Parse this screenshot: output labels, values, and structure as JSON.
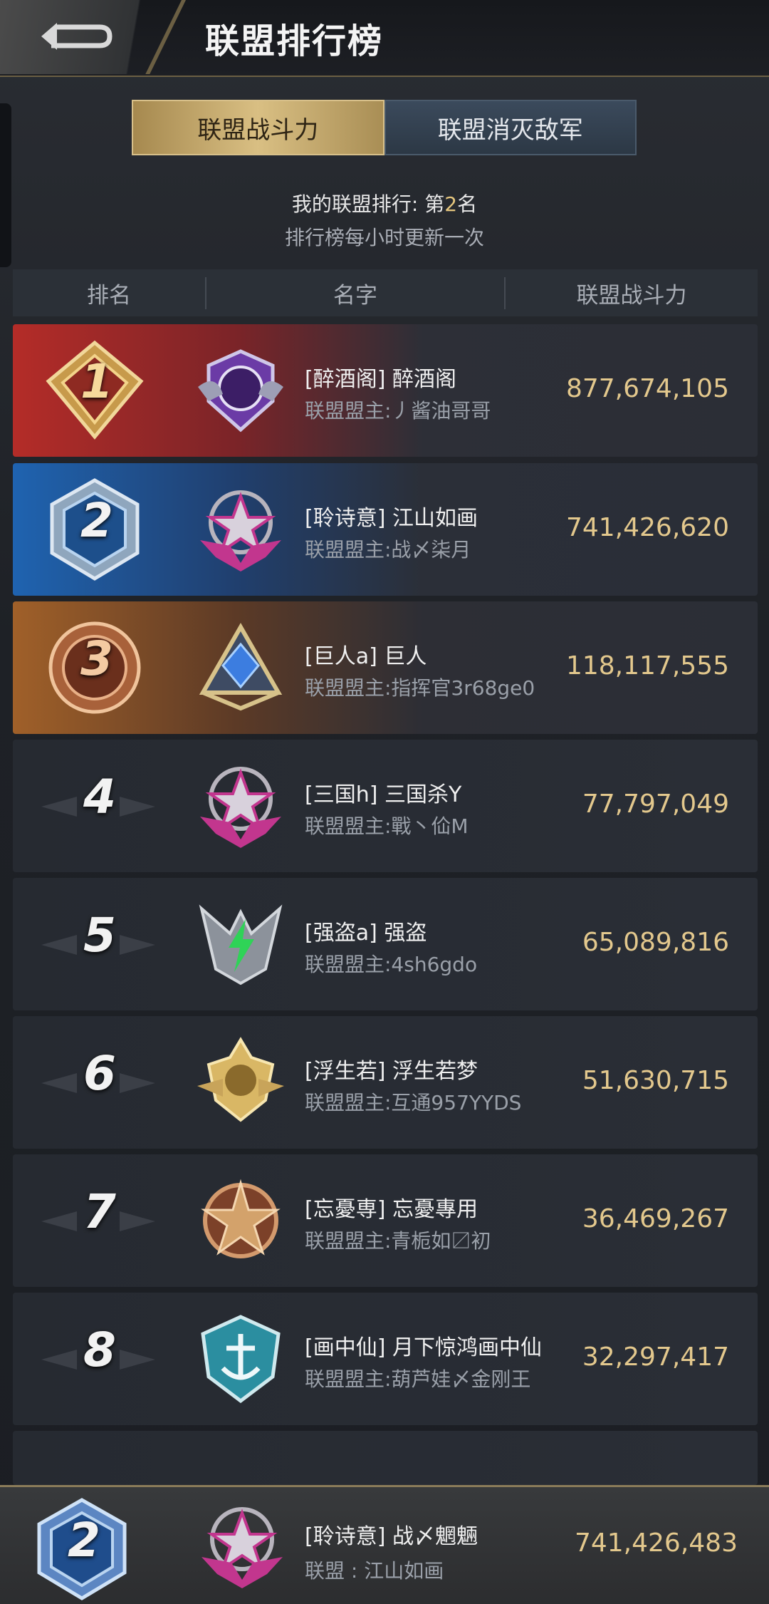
{
  "header": {
    "title": "联盟排行榜"
  },
  "tabs": [
    {
      "label": "联盟战斗力",
      "active": true
    },
    {
      "label": "联盟消灭敌军",
      "active": false
    }
  ],
  "my_rank": {
    "prefix": "我的联盟排行: 第",
    "rank": "2",
    "suffix": "名"
  },
  "update_note": "排行榜每小时更新一次",
  "columns": {
    "rank": "排名",
    "name": "名字",
    "power": "联盟战斗力"
  },
  "rows": [
    {
      "rank": "1",
      "name": "[醉酒阁] 醉酒阁",
      "leader": "联盟盟主:丿酱油哥哥",
      "power": "877,674,105",
      "emblem": "purple-tiger-emblem-icon"
    },
    {
      "rank": "2",
      "name": "[聆诗意] 江山如画",
      "leader": "联盟盟主:战〆柒月",
      "power": "741,426,620",
      "emblem": "pink-star-emblem-icon"
    },
    {
      "rank": "3",
      "name": "[巨人a] 巨人",
      "leader": "联盟盟主:指挥官3r68ge0",
      "power": "118,117,555",
      "emblem": "blue-gem-emblem-icon"
    },
    {
      "rank": "4",
      "name": "[三国h] 三国杀Y",
      "leader": "联盟盟主:戰丶佡M",
      "power": "77,797,049",
      "emblem": "pink-star-emblem-icon"
    },
    {
      "rank": "5",
      "name": "[强盗a] 强盗",
      "leader": "联盟盟主:4sh6gdo",
      "power": "65,089,816",
      "emblem": "green-bolt-emblem-icon"
    },
    {
      "rank": "6",
      "name": "[浮生若] 浮生若梦",
      "leader": "联盟盟主:互通957YYDS",
      "power": "51,630,715",
      "emblem": "gold-lion-emblem-icon"
    },
    {
      "rank": "7",
      "name": "[忘憂専] 忘憂專用",
      "leader": "联盟盟主:青栀如〼初",
      "power": "36,469,267",
      "emblem": "bronze-star-emblem-icon"
    },
    {
      "rank": "8",
      "name": "[画中仙] 月下惊鸿画中仙",
      "leader": "联盟盟主:葫芦娃〆金刚王",
      "power": "32,297,417",
      "emblem": "cyan-anchor-emblem-icon"
    }
  ],
  "footer": {
    "rank": "2",
    "name": "[聆诗意] 战〆魍魎",
    "leader": "联盟 : 江山如画",
    "power": "741,426,483",
    "emblem": "pink-star-emblem-icon"
  },
  "colors": {
    "gold": "#e3c88d",
    "rank1": "#b42c28",
    "rank2": "#1f63b0",
    "rank3": "#a06029"
  }
}
